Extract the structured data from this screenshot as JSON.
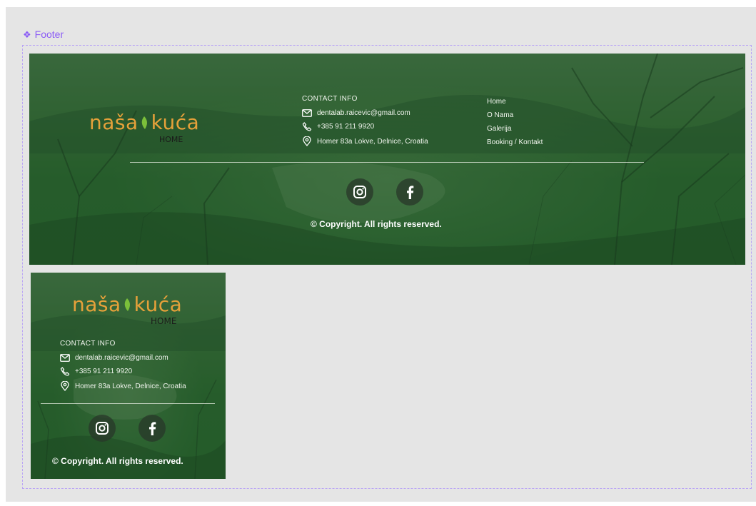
{
  "component": {
    "label": "Footer"
  },
  "brand": {
    "name_part1": "naša",
    "name_part2": "kuća",
    "tagline": "HOME"
  },
  "contact": {
    "title": "CONTACT INFO",
    "email": "dentalab.raicevic@gmail.com",
    "phone": "+385 91 211 9920",
    "address": "Homer 83a Lokve, Delnice, Croatia"
  },
  "nav": {
    "items": [
      "Home",
      "O Nama",
      "Galerija",
      "Booking / Kontakt"
    ]
  },
  "social": {
    "icons": [
      "instagram-icon",
      "facebook-icon"
    ]
  },
  "copyright": "© Copyright. All rights reserved.",
  "colors": {
    "accent_purple": "#8b5cf6",
    "brand_orange": "#e6a13a",
    "footer_green": "#2f5f32",
    "canvas_gray": "#e5e5e5"
  }
}
